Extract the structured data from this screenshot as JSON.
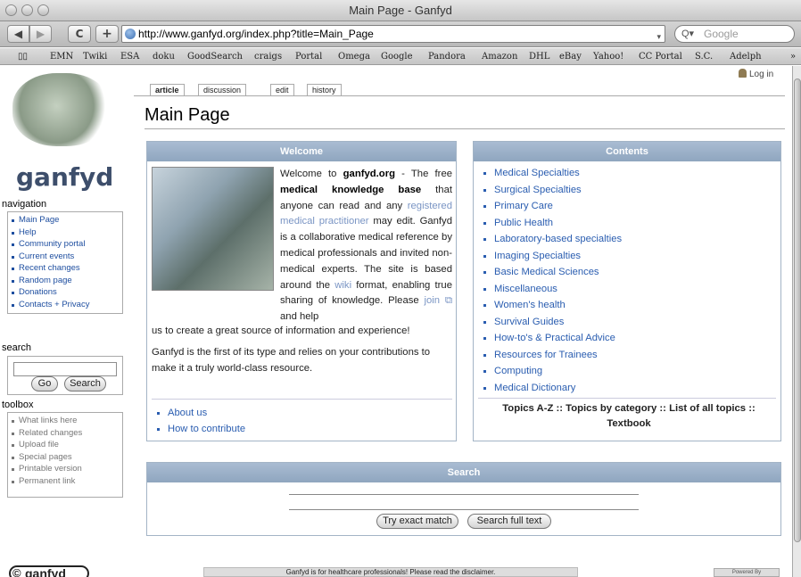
{
  "window": {
    "title": "Main Page - Ganfyd"
  },
  "toolbar": {
    "url": "http://www.ganfyd.org/index.php?title=Main_Page",
    "search_placeholder": "Google",
    "back_label": "◀",
    "forward_label": "▶",
    "reload_label": "C",
    "add_label": "+"
  },
  "bookmarks": {
    "items": [
      "EMN",
      "Twiki",
      "ESA",
      "doku",
      "GoodSearch",
      "craigs",
      "Portal",
      "Omega",
      "Google",
      "Pandora",
      "Amazon",
      "DHL",
      "eBay",
      "Yahoo!",
      "CC Portal",
      "S.C.",
      "Adelph"
    ],
    "overflow": "»"
  },
  "user": {
    "login": "Log in"
  },
  "sidebar": {
    "logo": "ganfyd",
    "navigation_title": "navigation",
    "navigation": [
      "Main Page",
      "Help",
      "Community portal",
      "Current events",
      "Recent changes",
      "Random page",
      "Donations",
      "Contacts + Privacy"
    ],
    "search_title": "search",
    "go_label": "Go",
    "search_label": "Search",
    "toolbox_title": "toolbox",
    "toolbox": [
      "What links here",
      "Related changes",
      "Upload file",
      "Special pages",
      "Printable version",
      "Permanent link"
    ]
  },
  "tabs": [
    "article",
    "discussion",
    "edit",
    "history"
  ],
  "page": {
    "title": "Main Page"
  },
  "welcome": {
    "header": "Welcome",
    "p1_a": "Welcome to ",
    "p1_site": "ganfyd.org",
    "p1_b": " - The free ",
    "p1_kb": "medical knowledge base",
    "p1_c": " that anyone can read and any ",
    "p1_reg": "registered medical practitioner",
    "p1_d": " may edit. Ganfyd is a collaborative medical reference by medical professionals and invited non-medical experts. The site is based around the ",
    "p1_wiki": "wiki",
    "p1_e": " format, enabling true sharing of knowledge. Please ",
    "p1_join": "join",
    "p1_f": " and help",
    "p1_tail": "us to create a great source of information and experience!",
    "p2": "Ganfyd is the first of its type and relies on your contributions to make it a truly world-class resource.",
    "links": [
      "About us",
      "How to contribute"
    ]
  },
  "contents": {
    "header": "Contents",
    "items": [
      "Medical Specialties",
      "Surgical Specialties",
      "Primary Care",
      "Public Health",
      "Laboratory-based specialties",
      "Imaging Specialties",
      "Basic Medical Sciences",
      "Miscellaneous",
      "Women's health",
      "Survival Guides",
      "How-to's & Practical Advice",
      "Resources for Trainees",
      "Computing",
      "Medical Dictionary"
    ],
    "topics_line1": "Topics A-Z :: Topics by category :: List of all topics ::",
    "topics_line2": "Textbook"
  },
  "search_panel": {
    "header": "Search",
    "exact_label": "Try exact match",
    "full_label": "Search full text"
  },
  "footer": {
    "logo": "ganfyd",
    "message": "Ganfyd is for healthcare professionals! Please read the disclaimer.",
    "powered": "Powered By"
  }
}
